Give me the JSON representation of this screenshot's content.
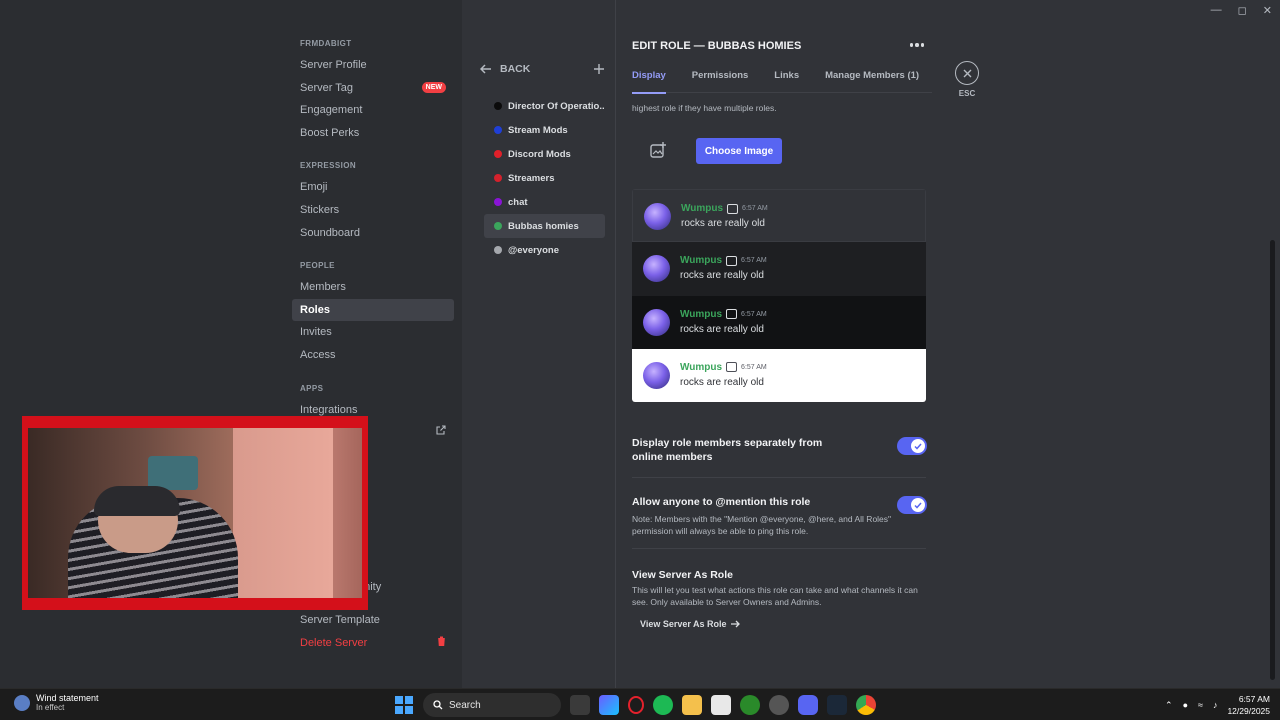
{
  "left_nav": {
    "sections": [
      {
        "header": "FRMDABIGT",
        "items": [
          {
            "label": "Server Profile"
          },
          {
            "label": "Server Tag",
            "badge": "NEW"
          },
          {
            "label": "Engagement"
          },
          {
            "label": "Boost Perks"
          }
        ]
      },
      {
        "header": "EXPRESSION",
        "items": [
          {
            "label": "Emoji"
          },
          {
            "label": "Stickers"
          },
          {
            "label": "Soundboard"
          }
        ]
      },
      {
        "header": "PEOPLE",
        "items": [
          {
            "label": "Members"
          },
          {
            "label": "Roles",
            "active": true
          },
          {
            "label": "Invites"
          },
          {
            "label": "Access"
          }
        ]
      },
      {
        "header": "APPS",
        "items": [
          {
            "label": "Integrations"
          }
        ]
      }
    ],
    "partial_label": "unity",
    "server_template": "Server Template",
    "delete_server": "Delete Server"
  },
  "roles_panel": {
    "back_label": "BACK",
    "add_icon": "plus-icon",
    "roles": [
      {
        "name": "Director Of Operatio...",
        "color": "#0b0b0b"
      },
      {
        "name": "Stream Mods",
        "color": "#1f3fd6"
      },
      {
        "name": "Discord Mods",
        "color": "#e0202a"
      },
      {
        "name": "Streamers",
        "color": "#d4212c"
      },
      {
        "name": "chat",
        "color": "#8a14d6"
      },
      {
        "name": "Bubbas homies",
        "color": "#3ba55c",
        "active": true
      },
      {
        "name": "@everyone",
        "color": "#a5a8ad"
      }
    ]
  },
  "editor": {
    "title": "EDIT ROLE — BUBBAS HOMIES",
    "tabs": [
      "Display",
      "Permissions",
      "Links",
      "Manage Members (1)"
    ],
    "active_tab": "Display",
    "esc_label": "ESC",
    "hint_text": "highest role if they have multiple roles.",
    "choose_image_label": "Choose Image",
    "preview_messages": [
      {
        "user": "Wumpus",
        "time": "6:57 AM",
        "text": "rocks are really old"
      },
      {
        "user": "Wumpus",
        "time": "6:57 AM",
        "text": "rocks are really old"
      },
      {
        "user": "Wumpus",
        "time": "6:57 AM",
        "text": "rocks are really old"
      },
      {
        "user": "Wumpus",
        "time": "6:57 AM",
        "text": "rocks are really old"
      }
    ],
    "display_separately": {
      "label": "Display role members separately from online members",
      "enabled": true
    },
    "allow_mention": {
      "label": "Allow anyone to @mention this role",
      "note": "Note: Members with the \"Mention @everyone, @here, and All Roles\" permission will always be able to ping this role.",
      "enabled": true
    },
    "view_as_role": {
      "title": "View Server As Role",
      "description": "This will let you test what actions this role can take and what channels it can see. Only available to Server Owners and Admins.",
      "button_label": "View Server As Role"
    }
  },
  "colors": {
    "accent": "#5865f2",
    "danger": "#f23f43",
    "role_name": "#3ba55c",
    "webcam_border": "#d4101a"
  },
  "taskbar": {
    "weather_title": "Wind statement",
    "weather_sub": "In effect",
    "search_label": "Search",
    "time": "6:57 AM",
    "date": "12/29/2025"
  }
}
